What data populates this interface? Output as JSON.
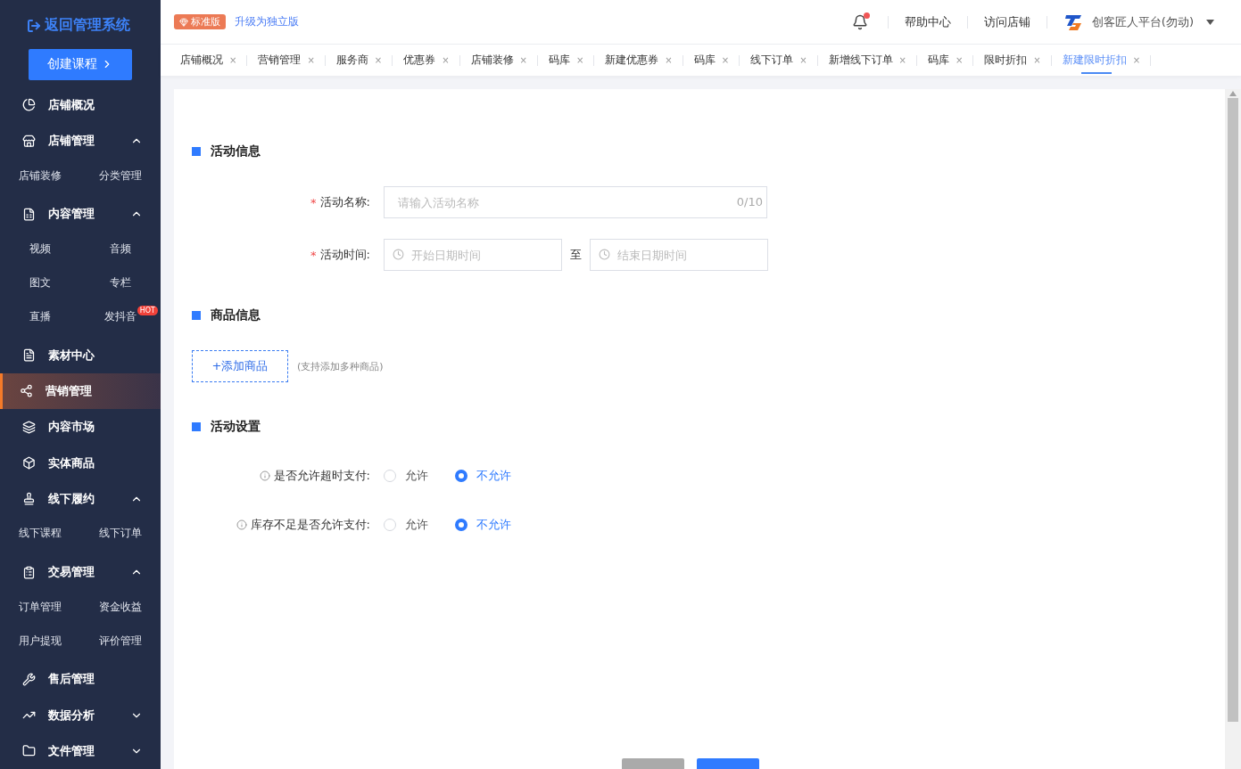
{
  "sidebar": {
    "back_link": "返回管理系统",
    "create_button": "创建课程",
    "items": [
      {
        "kind": "item",
        "label": "店铺概况",
        "selected": false
      },
      {
        "kind": "group",
        "label": "店铺管理",
        "expanded": true,
        "children": [
          {
            "label": "店铺装修"
          },
          {
            "label": "分类管理"
          }
        ]
      },
      {
        "kind": "group",
        "label": "内容管理",
        "expanded": true,
        "children": [
          {
            "label": "视频"
          },
          {
            "label": "音频"
          },
          {
            "label": "图文"
          },
          {
            "label": "专栏"
          },
          {
            "label": "直播"
          },
          {
            "label": "发抖音",
            "badge": "HOT"
          }
        ]
      },
      {
        "kind": "item",
        "label": "素材中心",
        "selected": false
      },
      {
        "kind": "item",
        "label": "营销管理",
        "selected": true
      },
      {
        "kind": "item",
        "label": "内容市场",
        "selected": false
      },
      {
        "kind": "item",
        "label": "实体商品",
        "selected": false
      },
      {
        "kind": "group",
        "label": "线下履约",
        "expanded": true,
        "children": [
          {
            "label": "线下课程"
          },
          {
            "label": "线下订单"
          }
        ]
      },
      {
        "kind": "group",
        "label": "交易管理",
        "expanded": true,
        "children": [
          {
            "label": "订单管理"
          },
          {
            "label": "资金收益"
          },
          {
            "label": "用户提现"
          },
          {
            "label": "评价管理"
          }
        ]
      },
      {
        "kind": "item",
        "label": "售后管理",
        "selected": false
      },
      {
        "kind": "group",
        "label": "数据分析",
        "expanded": false
      },
      {
        "kind": "group",
        "label": "文件管理",
        "expanded": false
      }
    ]
  },
  "header": {
    "edition_badge": "标准版",
    "upgrade_link": "升级为独立版",
    "notification_dot": true,
    "links": [
      "帮助中心",
      "访问店铺"
    ],
    "account": "创客匠人平台(勿动)"
  },
  "tabs": [
    {
      "label": "店铺概况",
      "close": "×",
      "selected": false
    },
    {
      "label": "营销管理",
      "close": "×",
      "selected": false
    },
    {
      "label": "服务商",
      "close": "×",
      "selected": false
    },
    {
      "label": "优惠券",
      "close": "×",
      "selected": false
    },
    {
      "label": "店铺装修",
      "close": "×",
      "selected": false
    },
    {
      "label": "码库",
      "close": "×",
      "selected": false
    },
    {
      "label": "新建优惠券",
      "close": "×",
      "selected": false
    },
    {
      "label": "码库",
      "close": "×",
      "selected": false
    },
    {
      "label": "线下订单",
      "close": "×",
      "selected": false
    },
    {
      "label": "新增线下订单",
      "close": "×",
      "selected": false
    },
    {
      "label": "码库",
      "close": "×",
      "selected": false
    },
    {
      "label": "限时折扣",
      "close": "×",
      "selected": false
    },
    {
      "label": "新建限时折扣",
      "close": "×",
      "selected": true
    }
  ],
  "form": {
    "activity_info": {
      "title": "活动信息",
      "name_field": {
        "required_mark": "*",
        "label": "活动名称:",
        "placeholder": "请输入活动名称",
        "counter": "0/10"
      },
      "time_field": {
        "required_mark": "*",
        "label": "活动时间:",
        "start_placeholder": "开始日期时间",
        "separator": "至",
        "end_placeholder": "结束日期时间"
      }
    },
    "product_info": {
      "title": "商品信息",
      "add_button": "+添加商品",
      "hint": "(支持添加多种商品)"
    },
    "settings": {
      "title": "活动设置",
      "options": [
        {
          "label": "是否允许超时支付:",
          "choices": [
            {
              "label": "允许",
              "selected": false
            },
            {
              "label": "不允许",
              "selected": true
            }
          ]
        },
        {
          "label": "库存不足是否允许支付:",
          "choices": [
            {
              "label": "允许",
              "selected": false
            },
            {
              "label": "不允许",
              "selected": true
            }
          ]
        }
      ]
    }
  },
  "footer_buttons": [
    {
      "kind": "secondary"
    },
    {
      "kind": "primary"
    }
  ]
}
